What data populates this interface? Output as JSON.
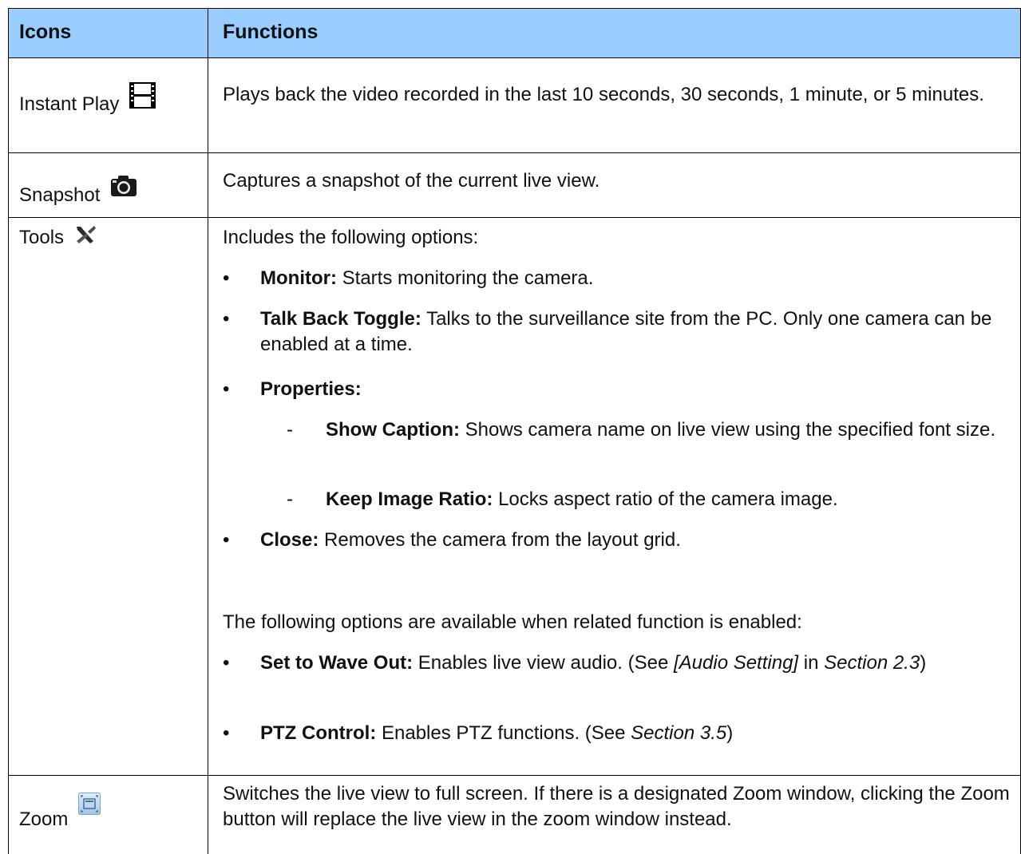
{
  "header": {
    "col1": "Icons",
    "col2": "Functions"
  },
  "rows": {
    "instant_play": {
      "name": "Instant Play",
      "icon": "film-icon",
      "desc": "Plays back the video recorded in the last 10 seconds, 30 seconds, 1 minute, or 5 minutes."
    },
    "snapshot": {
      "name": "Snapshot",
      "icon": "camera-icon",
      "desc": "Captures a snapshot of the current live view."
    },
    "tools": {
      "name": "Tools",
      "icon": "tools-icon",
      "intro": "Includes the following options:",
      "monitor_label": "Monitor:",
      "monitor_text": "Starts monitoring the camera.",
      "talkback_label": "Talk Back Toggle:",
      "talkback_text": "Talks to the surveillance site from the PC. Only one camera can be enabled at a time.",
      "properties_label": "Properties:",
      "caption_label": "Show Caption:",
      "caption_text": "Shows camera name on live view using the specified font size.",
      "ratio_label": "Keep Image Ratio:",
      "ratio_text": "Locks aspect ratio of the camera image.",
      "close_label": "Close:",
      "close_text": "Removes the camera from the layout grid.",
      "following": "The following options are available when related function is enabled:",
      "wave_label": "Set to Wave Out:",
      "wave_text_a": "Enables live view audio. (See ",
      "wave_ref1": "[Audio Setting]",
      "wave_text_b": " in ",
      "wave_ref2": "Section 2.3",
      "wave_text_c": ")",
      "ptz_label": "PTZ Control:",
      "ptz_text_a": "Enables PTZ functions. (See ",
      "ptz_ref": "Section 3.5",
      "ptz_text_b": ")"
    },
    "zoom": {
      "name": "Zoom",
      "icon": "zoom-fullscreen-icon",
      "desc": "Switches the live view to full screen. If there is a designated Zoom window, clicking the Zoom button will replace the live view in the zoom window instead."
    }
  },
  "bullet_char": "•",
  "dash_char": "-"
}
